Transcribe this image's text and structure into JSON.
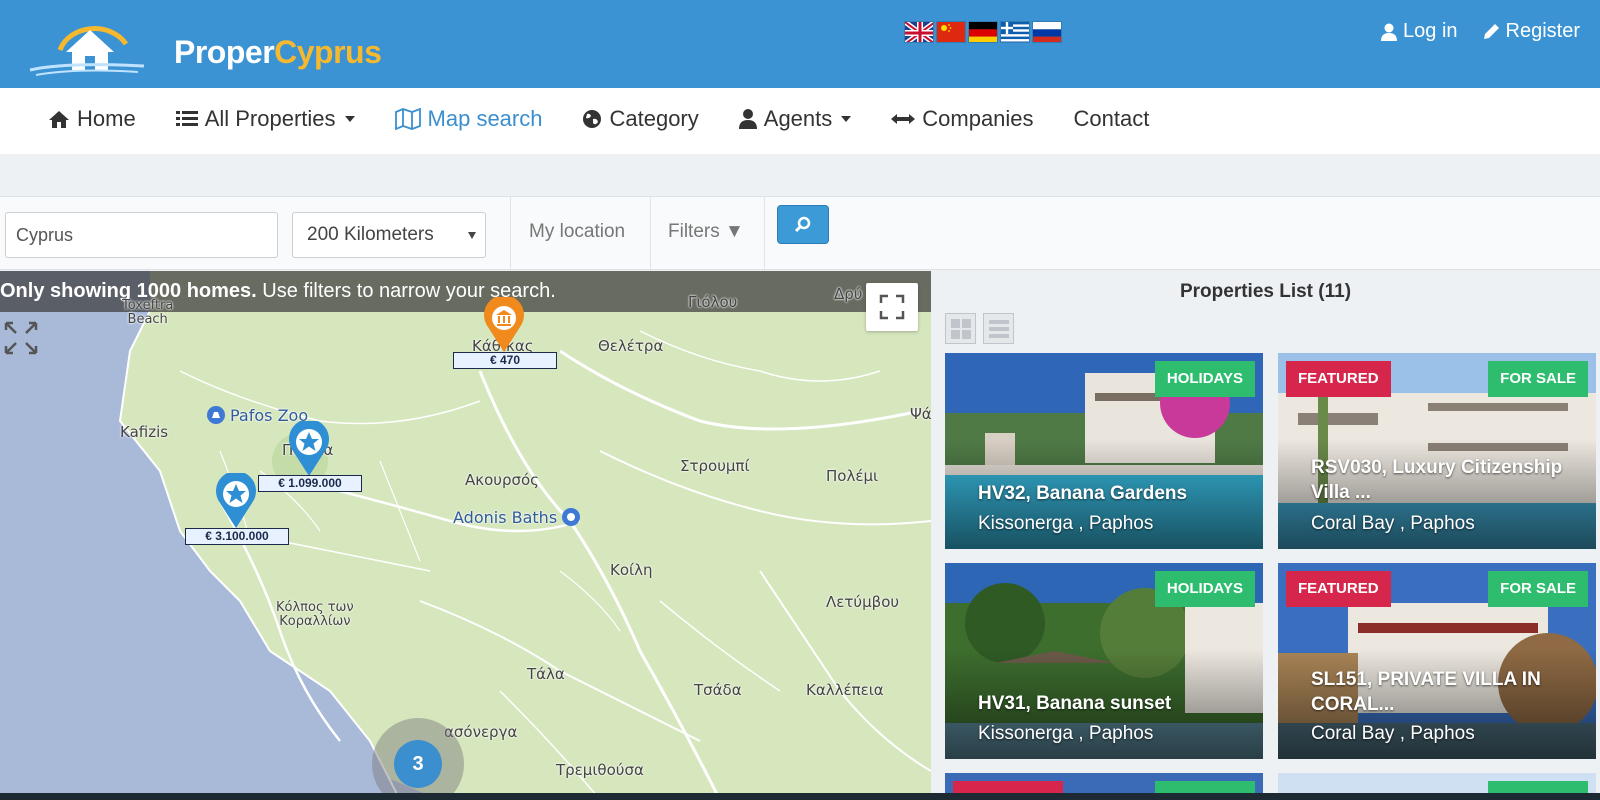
{
  "header": {
    "logo_word1": "Proper",
    "logo_word2": "Cyprus",
    "languages": [
      "uk-flag-icon",
      "china-flag-icon",
      "germany-flag-icon",
      "greece-flag-icon",
      "russia-flag-icon"
    ],
    "login_label": "Log in",
    "register_label": "Register",
    "brand_color": "#3b93d3",
    "accent_color": "#f5b82e"
  },
  "nav": {
    "home": "Home",
    "all_properties": "All Properties",
    "map_search": "Map search",
    "category": "Category",
    "agents": "Agents",
    "companies": "Companies",
    "contact": "Contact"
  },
  "search": {
    "location_value": "Cyprus",
    "radius_value": "200 Kilometers",
    "my_location": "My location",
    "filters": "Filters ▼"
  },
  "map": {
    "notice_bold": "Only showing 1000 homes.",
    "notice_rest": " Use filters to narrow your search.",
    "places": {
      "toxeftra": "Toxeftra\nBeach",
      "giolou": "Γιόλου",
      "dry": "Δρύ",
      "kathikas": "Κάθικας",
      "theletra": "Θελέτρα",
      "kafizis": "Kafizis",
      "pafos_zoo": "Pafos Zoo",
      "pegeia": "Πέγεια",
      "akoursos": "Ακουρσός",
      "stroumpi": "Στρουμπί",
      "polemi": "Πολέμι",
      "psathi": "Ψά",
      "adonis_baths": "Adonis Baths",
      "koili": "Κοίλη",
      "kolpos": "Κόλπος των\nΚοραλλίων",
      "letymvou": "Λετύμβου",
      "tala": "Τάλα",
      "tsada": "Τσάδα",
      "kallepeia": "Καλλέπεια",
      "chlorakas": "ασόνεργα",
      "tremithousa": "Τρεμιθούσα"
    },
    "markers": [
      {
        "price": "€ 470",
        "type": "institution"
      },
      {
        "price": "€ 1.099.000",
        "type": "star"
      },
      {
        "price": "€ 3.100.000",
        "type": "star"
      }
    ],
    "cluster_count": "3"
  },
  "list": {
    "title": "Properties List (11)",
    "cards": [
      {
        "badge": "HOLIDAYS",
        "title": "HV32, Banana Gardens",
        "location": "Kissonerga , Paphos"
      },
      {
        "badge_featured": "FEATURED",
        "badge": "FOR SALE",
        "title": "RSV030, Luxury Citizenship Villa ...",
        "location": "Coral Bay , Paphos"
      },
      {
        "badge": "HOLIDAYS",
        "title": "HV31, Banana sunset",
        "location": "Kissonerga , Paphos"
      },
      {
        "badge_featured": "FEATURED",
        "badge": "FOR SALE",
        "title": "SL151, PRIVATE VILLA IN CORAL...",
        "location": "Coral Bay , Paphos"
      }
    ]
  }
}
